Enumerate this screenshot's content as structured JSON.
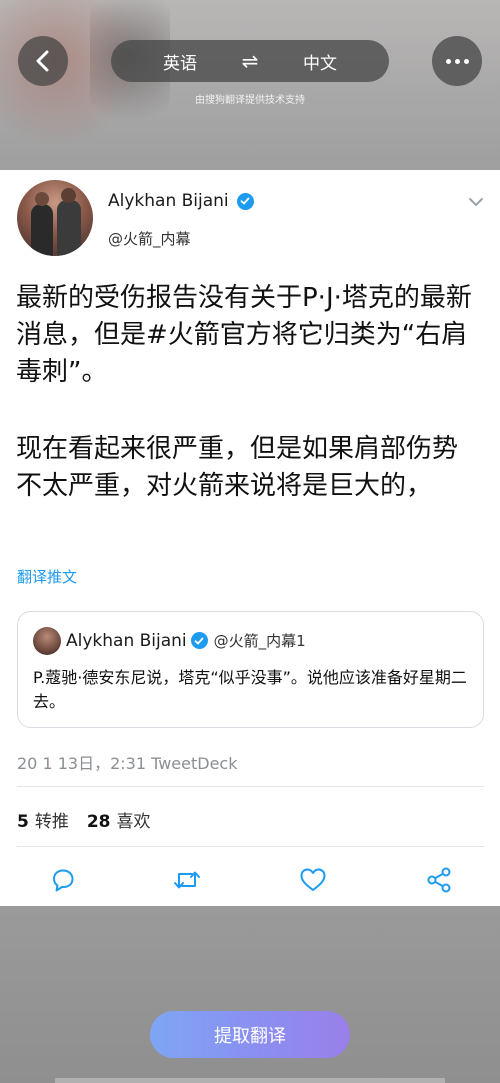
{
  "header": {
    "source_lang": "英语",
    "swap_symbol": "⇌",
    "target_lang": "中文",
    "powered_by": "由搜狗翻译提供技术支持"
  },
  "tweet": {
    "author_name": "Alykhan Bijani",
    "author_handle": "@火箭_内幕",
    "text_line1": "最新的受伤报告没有关于P·J·塔克的最新消息，但是#火箭官方将它归类为“右肩毒刺”。",
    "text_line2": "现在看起来很严重，但是如果肩部伤势不太严重，对火箭来说将是巨大的，",
    "translate_link": "翻译推文",
    "quote": {
      "author_name": "Alykhan Bijani",
      "author_handle": "@火箭_内幕1",
      "text": "P.蔻驰·德安东尼说，塔克“似乎没事”。说他应该准备好星期二去。"
    },
    "timestamp": "20 1 13日，2:31 TweetDeck",
    "retweets_count": "5",
    "retweets_label": "转推",
    "likes_count": "28",
    "likes_label": "喜欢"
  },
  "footer": {
    "extract_button": "提取翻译"
  },
  "colors": {
    "accent": "#1d9bf0",
    "button_gradient_start": "#7ea6f5",
    "button_gradient_end": "#9a7fe9"
  }
}
